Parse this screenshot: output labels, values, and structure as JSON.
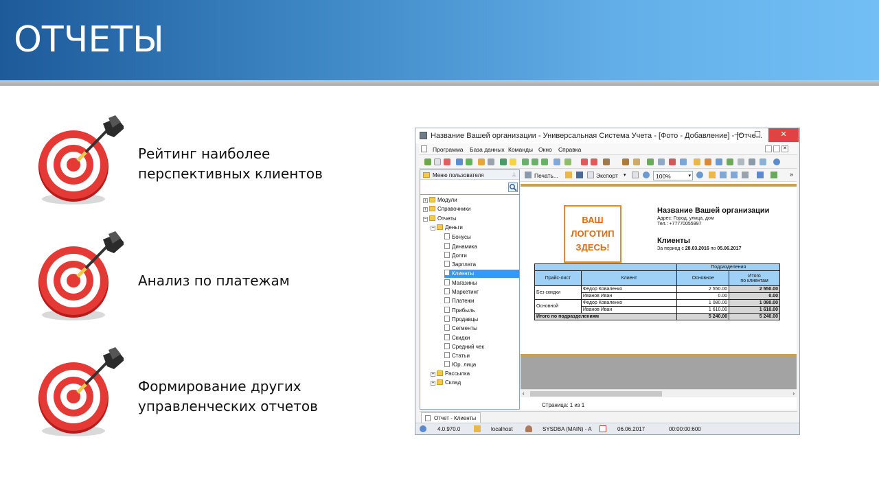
{
  "slide": {
    "title": "ОТЧЕТЫ",
    "bullets": [
      {
        "line1": "Рейтинг наиболее",
        "line2": "перспективных клиентов"
      },
      {
        "line1": "Анализ по платежам",
        "line2": ""
      },
      {
        "line1": "Формирование других",
        "line2": "управленческих отчетов"
      }
    ]
  },
  "window": {
    "title": "Название Вашей организации - Универсальная Система Учета - [Фото - Добавление] - [Отче...",
    "menu": [
      "Программа",
      "База данных",
      "Команды",
      "Окно",
      "Справка"
    ],
    "left_pane": {
      "header": "Меню пользователя",
      "tree": [
        {
          "label": "Модули",
          "level": 0,
          "type": "folder",
          "expander": "+"
        },
        {
          "label": "Справочники",
          "level": 0,
          "type": "folder",
          "expander": "+"
        },
        {
          "label": "Отчеты",
          "level": 0,
          "type": "folder",
          "expander": "−"
        },
        {
          "label": "Деньги",
          "level": 1,
          "type": "folder",
          "expander": "−"
        },
        {
          "label": "Бонусы",
          "level": 2,
          "type": "doc"
        },
        {
          "label": "Динамика",
          "level": 2,
          "type": "doc"
        },
        {
          "label": "Долги",
          "level": 2,
          "type": "doc"
        },
        {
          "label": "Зарплата",
          "level": 2,
          "type": "doc"
        },
        {
          "label": "Клиенты",
          "level": 2,
          "type": "doc",
          "selected": true
        },
        {
          "label": "Магазины",
          "level": 2,
          "type": "doc"
        },
        {
          "label": "Маркетинг",
          "level": 2,
          "type": "doc"
        },
        {
          "label": "Платежи",
          "level": 2,
          "type": "doc"
        },
        {
          "label": "Прибыль",
          "level": 2,
          "type": "doc"
        },
        {
          "label": "Продавцы",
          "level": 2,
          "type": "doc"
        },
        {
          "label": "Сегменты",
          "level": 2,
          "type": "doc"
        },
        {
          "label": "Скидки",
          "level": 2,
          "type": "doc"
        },
        {
          "label": "Средний чек",
          "level": 2,
          "type": "doc"
        },
        {
          "label": "Статьи",
          "level": 2,
          "type": "doc"
        },
        {
          "label": "Юр. лица",
          "level": 2,
          "type": "doc"
        },
        {
          "label": "Рассылка",
          "level": 1,
          "type": "folder",
          "expander": "+"
        },
        {
          "label": "Склад",
          "level": 1,
          "type": "folder",
          "expander": "+"
        }
      ]
    },
    "report_toolbar": {
      "print": "Печать...",
      "export": "Экспорт",
      "zoom": "100%"
    },
    "report": {
      "logo_lines": [
        "ВАШ",
        "ЛОГОТИП",
        "ЗДЕСЬ!"
      ],
      "org_name": "Название Вашей организации",
      "address": "Адрес: Город, улица, дом",
      "phone": "Тел.: +77770055997",
      "title": "Клиенты",
      "period_prefix": "За период с",
      "period_from": "28.03.2016",
      "period_mid": "по",
      "period_to": "05.06.2017",
      "headers": {
        "price_list": "Прайс-лист",
        "client": "Клиент",
        "divisions": "Подразделения",
        "main": "Основное",
        "total_line1": "Итого",
        "total_line2": "по клиентам"
      },
      "groups": [
        {
          "name": "Без скидки",
          "rows": [
            {
              "client": "Федор Коваленко",
              "main": "2 550.00",
              "total": "2 550.00"
            },
            {
              "client": "Иванов Иван",
              "main": "0.00",
              "total": "0.00"
            }
          ]
        },
        {
          "name": "Основной",
          "rows": [
            {
              "client": "Федор Коваленко",
              "main": "1 080.00",
              "total": "1 080.00"
            },
            {
              "client": "Иванов Иван",
              "main": "1 610.00",
              "total": "1 610.00"
            }
          ]
        }
      ],
      "summary": {
        "label": "Итого по подразделениям",
        "main": "5 240.00",
        "total": "5 240.00"
      }
    },
    "page_info": "Страница: 1 из 1",
    "tab": "Отчет - Клиенты",
    "status": {
      "version": "4.0.970.0",
      "host": "localhost",
      "user": "SYSDBA (MAIN) - A",
      "date": "06.06.2017",
      "time": "00:00:00:600"
    }
  }
}
